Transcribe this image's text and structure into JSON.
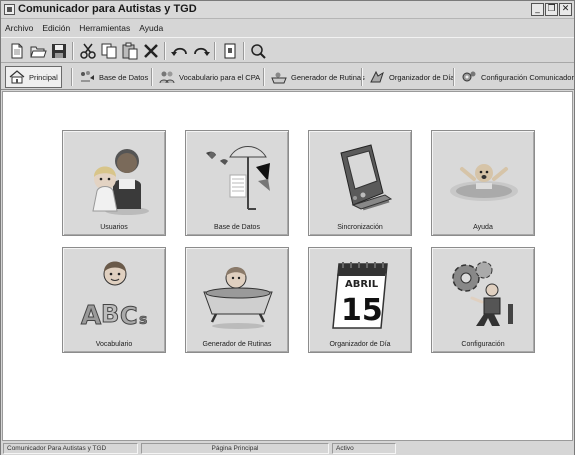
{
  "window": {
    "title": "Comunicador para Autistas y TGD",
    "minimize_glyph": "_",
    "restore_glyph": "❐",
    "close_glyph": "✕"
  },
  "menu": {
    "items": [
      {
        "label": "Archivo"
      },
      {
        "label": "Edición"
      },
      {
        "label": "Herramientas"
      },
      {
        "label": "Ayuda"
      }
    ]
  },
  "toolbar": {
    "buttons": [
      {
        "icon": "new-document-icon"
      },
      {
        "icon": "open-folder-icon"
      },
      {
        "icon": "save-icon"
      },
      {
        "icon": "cut-icon"
      },
      {
        "icon": "copy-icon"
      },
      {
        "icon": "paste-icon"
      },
      {
        "icon": "delete-icon"
      },
      {
        "icon": "undo-icon"
      },
      {
        "icon": "redo-icon"
      },
      {
        "icon": "properties-icon"
      },
      {
        "icon": "help-icon"
      }
    ]
  },
  "nav": {
    "tabs": [
      {
        "label": "Principal",
        "icon": "home-icon",
        "active": true
      },
      {
        "label": "Base de Datos",
        "icon": "database-icon",
        "active": false
      },
      {
        "label": "Vocabulario para el CPA",
        "icon": "vocabulary-icon",
        "active": false
      },
      {
        "label": "Generador de Rutinas",
        "icon": "routine-icon",
        "active": false
      },
      {
        "label": "Organizador de Día",
        "icon": "organizer-icon",
        "active": false
      },
      {
        "label": "Configuración Comunicador",
        "icon": "configuration-icon",
        "active": false
      }
    ]
  },
  "tiles": [
    {
      "label": "Usuarios",
      "icon": "users-icon"
    },
    {
      "label": "Base de Datos",
      "icon": "database-icon"
    },
    {
      "label": "Sincronización",
      "icon": "pda-sync-icon"
    },
    {
      "label": "Ayuda",
      "icon": "help-swimmer-icon"
    },
    {
      "label": "Vocabulario",
      "icon": "abc-icon"
    },
    {
      "label": "Generador de Rutinas",
      "icon": "bathtub-icon"
    },
    {
      "label": "Organizador de Día",
      "icon": "calendar-icon"
    },
    {
      "label": "Configuración",
      "icon": "gears-icon"
    }
  ],
  "calendar": {
    "month": "ABRIL",
    "day": "15"
  },
  "status": {
    "app_name": "Comunicador Para Autistas y TGD",
    "page": "Página Principal",
    "state": "Activo"
  }
}
